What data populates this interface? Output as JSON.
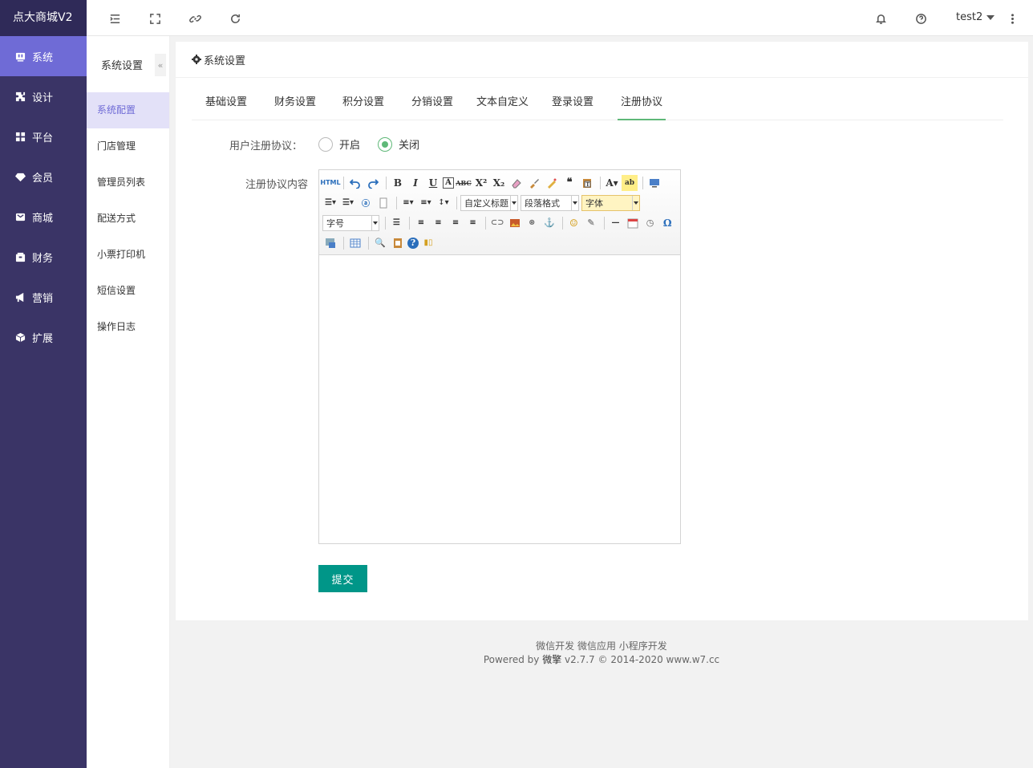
{
  "brand": "点大商城V2",
  "main_menu": [
    {
      "label": "系统",
      "icon": "system-icon",
      "active": true
    },
    {
      "label": "设计",
      "icon": "puzzle-icon",
      "active": false
    },
    {
      "label": "平台",
      "icon": "grid-icon",
      "active": false
    },
    {
      "label": "会员",
      "icon": "diamond-icon",
      "active": false
    },
    {
      "label": "商城",
      "icon": "mail-icon",
      "active": false
    },
    {
      "label": "财务",
      "icon": "wallet-icon",
      "active": false
    },
    {
      "label": "营销",
      "icon": "megaphone-icon",
      "active": false
    },
    {
      "label": "扩展",
      "icon": "cube-icon",
      "active": false
    }
  ],
  "topbar": {
    "icons": [
      "menu-fold-icon",
      "fullscreen-icon",
      "link-icon",
      "refresh-icon",
      "bell-icon",
      "help-icon",
      "more-icon"
    ],
    "user": "test2"
  },
  "sub_menu": {
    "title": "系统设置",
    "collapse": "«",
    "items": [
      "系统配置",
      "门店管理",
      "管理员列表",
      "配送方式",
      "小票打印机",
      "短信设置",
      "操作日志"
    ]
  },
  "card": {
    "title": "系统设置",
    "tabs": [
      "基础设置",
      "财务设置",
      "积分设置",
      "分销设置",
      "文本自定义",
      "登录设置",
      "注册协议"
    ],
    "active_tab": 6
  },
  "form": {
    "agreement_label": "用户注册协议：",
    "opt_on": "开启",
    "opt_off": "关闭",
    "selected": "关闭",
    "content_label": "注册协议内容",
    "submit": "提交"
  },
  "editor": {
    "html_btn": "HTML",
    "combo_title": "自定义标题",
    "combo_paragraph": "段落格式",
    "combo_font": "字体",
    "combo_size": "字号"
  },
  "footer": {
    "line1": "微信开发 微信应用 小程序开发",
    "powered": "Powered by ",
    "brand": "微擎",
    "rest": " v2.7.7 © 2014-2020 www.w7.cc"
  },
  "colors": {
    "sidebar": "#3a3466",
    "active": "#6f6bd6",
    "primary": "#009688",
    "tab_underline": "#5fb878"
  }
}
